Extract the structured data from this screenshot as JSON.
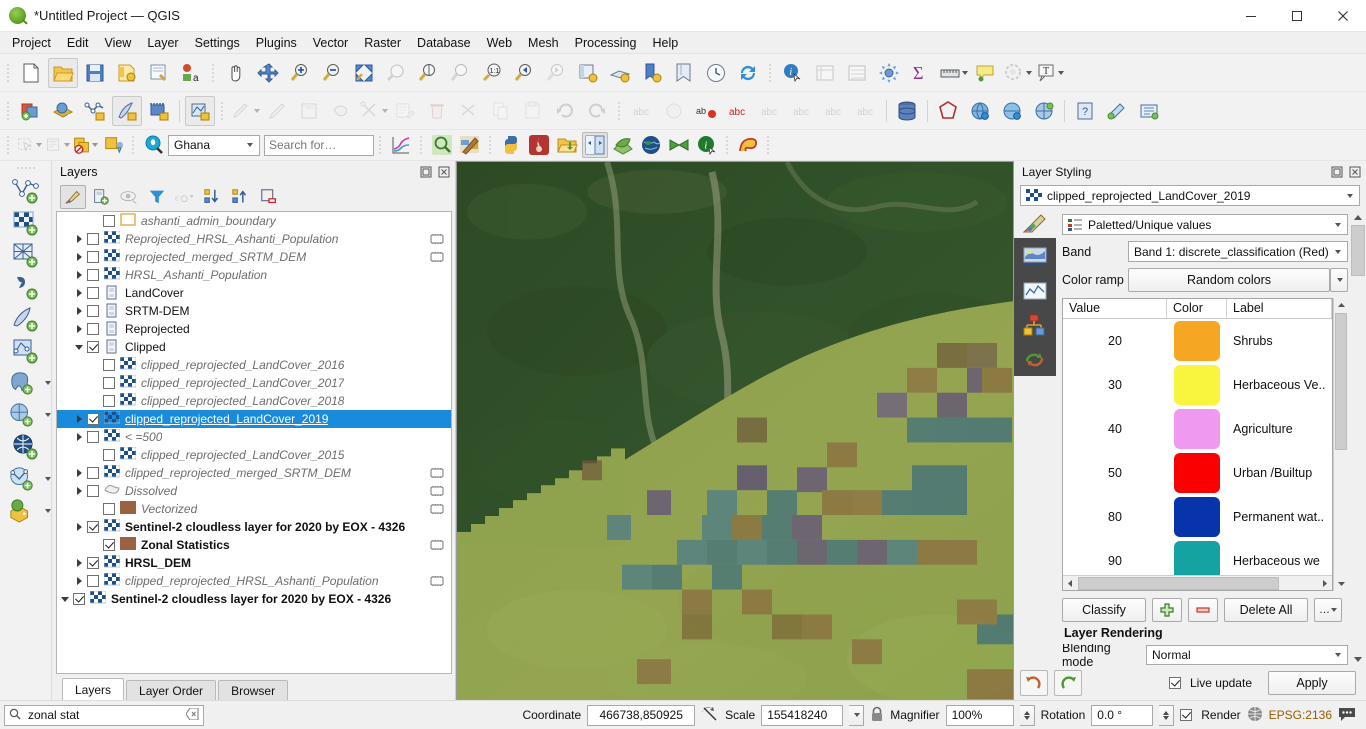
{
  "window": {
    "title": "*Untitled Project — QGIS",
    "app_icon": "qgis-logo-icon",
    "minimize_label": "Minimize",
    "maximize_label": "Maximize",
    "close_label": "Close"
  },
  "menubar": {
    "items": [
      {
        "label": "Project"
      },
      {
        "label": "Edit"
      },
      {
        "label": "View"
      },
      {
        "label": "Layer"
      },
      {
        "label": "Settings"
      },
      {
        "label": "Plugins"
      },
      {
        "label": "Vector"
      },
      {
        "label": "Raster"
      },
      {
        "label": "Database"
      },
      {
        "label": "Web"
      },
      {
        "label": "Mesh"
      },
      {
        "label": "Processing"
      },
      {
        "label": "Help"
      }
    ]
  },
  "toolbar_row1": {
    "buttons": [
      {
        "name": "new-project-icon",
        "title": "New Project"
      },
      {
        "name": "open-project-icon",
        "title": "Open Project"
      },
      {
        "name": "save-project-icon",
        "title": "Save Project"
      },
      {
        "name": "save-project-as-icon",
        "title": "Save Project As"
      },
      {
        "name": "new-print-layout-icon",
        "title": "New Print Layout"
      },
      {
        "name": "style-manager-icon",
        "title": "Style Manager"
      },
      {
        "name": "pan-map-icon",
        "title": "Pan Map"
      },
      {
        "name": "pan-to-selection-icon",
        "title": "Pan Map to Selection"
      },
      {
        "name": "zoom-in-icon",
        "title": "Zoom In"
      },
      {
        "name": "zoom-out-icon",
        "title": "Zoom Out"
      },
      {
        "name": "zoom-full-icon",
        "title": "Zoom Full"
      },
      {
        "name": "zoom-to-selection-icon",
        "title": "Zoom to Selection"
      },
      {
        "name": "zoom-to-layer-icon",
        "title": "Zoom to Layer"
      },
      {
        "name": "zoom-native-icon",
        "title": "Zoom to Native Resolution"
      },
      {
        "name": "zoom-last-icon",
        "title": "Zoom Last"
      },
      {
        "name": "zoom-next-icon",
        "title": "Zoom Next"
      },
      {
        "name": "new-map-view-icon",
        "title": "New Map View"
      },
      {
        "name": "new-3d-map-view-icon",
        "title": "New 3D Map View"
      },
      {
        "name": "bookmark-add-icon",
        "title": "New Spatial Bookmark"
      },
      {
        "name": "show-bookmarks-icon",
        "title": "Show Spatial Bookmarks"
      },
      {
        "name": "temporal-controller-icon",
        "title": "Temporal Controller Panel"
      },
      {
        "name": "refresh-icon",
        "title": "Refresh"
      },
      {
        "name": "identify-features-icon",
        "title": "Identify Features"
      },
      {
        "name": "attribute-table-icon",
        "title": "Open Attribute Table"
      },
      {
        "name": "statistical-summary-icon",
        "title": "Statistical Summary"
      },
      {
        "name": "options-icon",
        "title": "Options"
      },
      {
        "name": "sum-icon",
        "title": "Field Calculator"
      },
      {
        "name": "measure-line-icon",
        "title": "Measure Line"
      },
      {
        "name": "map-tips-icon",
        "title": "Show Map Tips"
      },
      {
        "name": "deselect-features-icon",
        "title": "Deselect Features"
      },
      {
        "name": "text-annotation-icon",
        "title": "Text Annotation"
      }
    ]
  },
  "toolbar_row2": {
    "buttons": [
      {
        "name": "add-layer-icon",
        "title": "Add Layer"
      },
      {
        "name": "open-data-source-manager-icon",
        "title": "Open Data Source Manager"
      },
      {
        "name": "add-vector-layer-icon",
        "title": "Add Vector Layer"
      },
      {
        "name": "add-raster-layer-icon",
        "title": "Add Raster Layer"
      },
      {
        "name": "add-mesh-layer-icon",
        "title": "Add Mesh Layer"
      },
      {
        "name": "add-delimited-text-layer-icon",
        "title": "Add Delimited Text Layer"
      },
      {
        "name": "current-edits-icon",
        "title": "Current Edits"
      },
      {
        "name": "toggle-editing-icon",
        "title": "Toggle Editing"
      },
      {
        "name": "save-layer-edits-icon",
        "title": "Save Layer Edits"
      },
      {
        "name": "add-polygon-feature-icon",
        "title": "Add Polygon Feature"
      },
      {
        "name": "vertex-tool-icon",
        "title": "Vertex Tool"
      },
      {
        "name": "modify-attributes-icon",
        "title": "Modify Attributes of Features"
      },
      {
        "name": "delete-selected-icon",
        "title": "Delete Selected"
      },
      {
        "name": "cut-features-icon",
        "title": "Cut Features"
      },
      {
        "name": "copy-features-icon",
        "title": "Copy Features"
      },
      {
        "name": "paste-features-icon",
        "title": "Paste Features"
      },
      {
        "name": "undo-icon",
        "title": "Undo"
      },
      {
        "name": "redo-icon",
        "title": "Redo"
      },
      {
        "name": "label-abc-icon",
        "title": "Layer Labeling Options"
      },
      {
        "name": "pin-labels-icon",
        "title": "Pin Labels"
      },
      {
        "name": "highlight-labels-icon",
        "title": "Highlight Pinned Labels"
      },
      {
        "name": "move-label-icon",
        "title": "Move Label"
      },
      {
        "name": "rotate-label-icon",
        "title": "Rotate Label"
      },
      {
        "name": "change-label-icon",
        "title": "Change Label"
      },
      {
        "name": "show-hide-labels-icon",
        "title": "Show/Hide Labels"
      },
      {
        "name": "database-icon",
        "title": "DB Manager"
      },
      {
        "name": "georeferencer-icon",
        "title": "Georeferencer"
      },
      {
        "name": "metasearch-icon",
        "title": "MetaSearch"
      },
      {
        "name": "qgis-cloud-icon",
        "title": "QGIS Cloud"
      },
      {
        "name": "globe-network-icon",
        "title": "Network"
      },
      {
        "name": "help-icon",
        "title": "Help"
      },
      {
        "name": "plugin-icon",
        "title": "Plugins"
      },
      {
        "name": "processing-toolbox-icon",
        "title": "Processing Toolbox"
      }
    ]
  },
  "toolbar_row3": {
    "buttons_left": [
      {
        "name": "select-features-icon",
        "title": "Select Features"
      },
      {
        "name": "select-by-form-icon",
        "title": "Select Features by Value"
      },
      {
        "name": "deselect-all-icon",
        "title": "Deselect All"
      },
      {
        "name": "select-by-location-icon",
        "title": "Select by Location"
      }
    ],
    "geocoder": {
      "icon": "location-pin-search-icon",
      "country_value": "Ghana",
      "search_placeholder": "Search for…",
      "search_value": ""
    },
    "buttons_right": [
      {
        "name": "plot-chart-icon",
        "title": "Data Plotly"
      },
      {
        "name": "search-magnifier-icon",
        "title": "Search"
      },
      {
        "name": "map-painting-icon",
        "title": "Map Styling"
      },
      {
        "name": "python-console-icon",
        "title": "Python Console"
      },
      {
        "name": "qgis-resource-sharing-icon",
        "title": "Resource Sharing"
      },
      {
        "name": "open-folder-icon",
        "title": "Open Folder"
      },
      {
        "name": "compare-panels-icon",
        "title": "Compare"
      },
      {
        "name": "leaf-qgis2web-icon",
        "title": "qgis2web"
      },
      {
        "name": "globe-dark-icon",
        "title": "Globe"
      },
      {
        "name": "green-mesh-icon",
        "title": "Mesh Tools"
      },
      {
        "name": "info-identify-icon",
        "title": "Info"
      },
      {
        "name": "freehand-draw-icon",
        "title": "Freehand Drawing"
      }
    ]
  },
  "left_toolbar": {
    "buttons": [
      {
        "name": "add-vector-layer-icon",
        "title": "Add Vector Layer"
      },
      {
        "name": "add-raster-layer-icon",
        "title": "Add Raster Layer"
      },
      {
        "name": "add-mesh-layer-icon",
        "title": "Add Mesh Layer"
      },
      {
        "name": "add-delimited-text-layer-icon",
        "title": "Add Delimited Text Layer"
      },
      {
        "name": "add-spatialite-layer-icon",
        "title": "Add SpatiaLite Layer"
      },
      {
        "name": "add-vector-tile-layer-icon",
        "title": "Add Vector Tile Layer"
      },
      {
        "name": "add-postgis-layer-icon",
        "title": "Add PostGIS Layer"
      },
      {
        "name": "add-wms-layer-icon",
        "title": "Add WMS/WMTS Layer"
      },
      {
        "name": "add-wfs-layer-icon",
        "title": "Add WFS Layer"
      },
      {
        "name": "add-wcs-layer-icon",
        "title": "Add WCS Layer"
      },
      {
        "name": "add-3d-layer-icon",
        "title": "Add 3D Layer"
      }
    ]
  },
  "layers_panel": {
    "title": "Layers",
    "undock_label": "Undock",
    "close_label": "Close",
    "toolbar": [
      {
        "name": "open-layer-styling-panel-icon",
        "title": "Open the Layer Styling panel",
        "active": true
      },
      {
        "name": "add-group-icon",
        "title": "Add Group"
      },
      {
        "name": "manage-layer-visibility-icon",
        "title": "Manage Map Themes"
      },
      {
        "name": "filter-legend-icon",
        "title": "Filter Legend by Map Content"
      },
      {
        "name": "filter-legend-expression-icon",
        "title": "Filter Legend by Expression"
      },
      {
        "name": "expand-all-icon",
        "title": "Expand All"
      },
      {
        "name": "collapse-all-icon",
        "title": "Collapse All"
      },
      {
        "name": "remove-layer-icon",
        "title": "Remove Layer/Group"
      }
    ],
    "tree": [
      {
        "label": "ashanti_admin_boundary",
        "icon": "polygon-outline-icon",
        "checked": false,
        "expander": "none",
        "indent": 1,
        "style": "italic",
        "chip": false
      },
      {
        "label": "Reprojected_HRSL_Ashanti_Population",
        "icon": "raster-icon",
        "checked": false,
        "expander": "right",
        "indent": 0,
        "style": "italic",
        "chip": true
      },
      {
        "label": "reprojected_merged_SRTM_DEM",
        "icon": "raster-icon",
        "checked": false,
        "expander": "right",
        "indent": 0,
        "style": "italic",
        "chip": true
      },
      {
        "label": "HRSL_Ashanti_Population",
        "icon": "raster-icon",
        "checked": false,
        "expander": "right",
        "indent": 0,
        "style": "italic",
        "chip": false
      },
      {
        "label": "LandCover",
        "icon": "group-icon",
        "checked": false,
        "expander": "right",
        "indent": 0,
        "style": "normal",
        "chip": false
      },
      {
        "label": "SRTM-DEM",
        "icon": "group-icon",
        "checked": false,
        "expander": "right",
        "indent": 0,
        "style": "normal",
        "chip": false
      },
      {
        "label": "Reprojected",
        "icon": "group-icon",
        "checked": false,
        "expander": "right",
        "indent": 0,
        "style": "normal",
        "chip": false
      },
      {
        "label": "Clipped",
        "icon": "group-icon",
        "checked": true,
        "expander": "down",
        "indent": 0,
        "style": "normal",
        "chip": false
      },
      {
        "label": "clipped_reprojected_LandCover_2016",
        "icon": "raster-icon",
        "checked": false,
        "expander": "none",
        "indent": 1,
        "style": "italic",
        "chip": false
      },
      {
        "label": "clipped_reprojected_LandCover_2017",
        "icon": "raster-icon",
        "checked": false,
        "expander": "none",
        "indent": 1,
        "style": "italic",
        "chip": false
      },
      {
        "label": "clipped_reprojected_LandCover_2018",
        "icon": "raster-icon",
        "checked": false,
        "expander": "none",
        "indent": 1,
        "style": "italic",
        "chip": false
      },
      {
        "label": "clipped_reprojected_LandCover_2019",
        "icon": "raster-icon",
        "checked": true,
        "expander": "right",
        "indent": 0,
        "style": "selected",
        "chip": false,
        "selected": true
      },
      {
        "label": "< =500",
        "icon": "raster-icon",
        "checked": false,
        "expander": "right",
        "indent": 0,
        "style": "italic",
        "chip": false
      },
      {
        "label": "clipped_reprojected_LandCover_2015",
        "icon": "raster-icon",
        "checked": false,
        "expander": "none",
        "indent": 1,
        "style": "italic",
        "chip": false
      },
      {
        "label": "clipped_reprojected_merged_SRTM_DEM",
        "icon": "raster-icon",
        "checked": false,
        "expander": "right",
        "indent": 0,
        "style": "italic",
        "chip": true
      },
      {
        "label": "Dissolved",
        "icon": "polygon-gray-icon",
        "checked": false,
        "expander": "right",
        "indent": 0,
        "style": "italic",
        "chip": true
      },
      {
        "label": "Vectorized",
        "icon": "polygon-brown-icon",
        "checked": false,
        "expander": "none",
        "indent": 1,
        "style": "italic",
        "chip": true
      },
      {
        "label": "Sentinel-2 cloudless layer for 2020 by EOX - 4326",
        "icon": "raster-icon",
        "checked": true,
        "expander": "right",
        "indent": 0,
        "style": "bold",
        "chip": false
      },
      {
        "label": "Zonal Statistics",
        "icon": "polygon-brown-icon",
        "checked": true,
        "expander": "none",
        "indent": 1,
        "style": "bold",
        "chip": true
      },
      {
        "label": "HRSL_DEM",
        "icon": "raster-icon",
        "checked": true,
        "expander": "right",
        "indent": 0,
        "style": "bold",
        "chip": false
      },
      {
        "label": "clipped_reprojected_HRSL_Ashanti_Population",
        "icon": "raster-icon",
        "checked": false,
        "expander": "right",
        "indent": 0,
        "style": "italic",
        "chip": true
      },
      {
        "label": "Sentinel-2 cloudless layer for 2020 by EOX - 4326",
        "icon": "raster-icon",
        "checked": true,
        "expander": "down",
        "indent": -1,
        "style": "bold",
        "chip": false
      }
    ],
    "tabs": [
      {
        "label": "Layers",
        "active": true
      },
      {
        "label": "Layer Order",
        "active": false
      },
      {
        "label": "Browser",
        "active": false
      }
    ]
  },
  "style_panel": {
    "title": "Layer Styling",
    "undock_label": "Undock",
    "close_label": "Close",
    "layer_selector": {
      "icon": "raster-icon",
      "value": "clipped_reprojected_LandCover_2019"
    },
    "side_buttons": [
      {
        "name": "symbology-brush-icon",
        "title": "Symbology"
      },
      {
        "name": "transparency-icon",
        "title": "Transparency"
      },
      {
        "name": "histogram-icon",
        "title": "Histogram"
      },
      {
        "name": "rendering-pyramids-icon",
        "title": "Rendering"
      },
      {
        "name": "history-undo-redo-icon",
        "title": "History"
      }
    ],
    "renderer": {
      "value": "Paletted/Unique values",
      "icon": "palette-list-icon"
    },
    "band": {
      "label": "Band",
      "value": "Band 1: discrete_classification (Red)"
    },
    "color_ramp": {
      "label": "Color ramp",
      "value": "Random colors"
    },
    "table": {
      "headers": [
        "Value",
        "Color",
        "Label"
      ],
      "rows": [
        {
          "value": "20",
          "color": "#f5a623",
          "label": "Shrubs"
        },
        {
          "value": "30",
          "color": "#f9f43e",
          "label": "Herbaceous Ve.."
        },
        {
          "value": "40",
          "color": "#ef9af0",
          "label": "Agriculture"
        },
        {
          "value": "50",
          "color": "#fb0000",
          "label": "Urban /Builtup"
        },
        {
          "value": "80",
          "color": "#0733ab",
          "label": "Permanent wat.."
        },
        {
          "value": "90",
          "color": "#14a3a0",
          "label": "Herbaceous we"
        }
      ]
    },
    "buttons": {
      "classify": "Classify",
      "add": "add-entry-icon",
      "remove": "remove-entry-icon",
      "delete_all": "Delete All",
      "more": "…"
    },
    "layer_rendering_title": "Layer Rendering",
    "blending_label": "Blending mode",
    "blending_value": "Normal",
    "footer": {
      "undo": "undo-icon",
      "redo": "redo-icon",
      "live_update_label": "Live update",
      "live_update_checked": true,
      "apply_label": "Apply"
    }
  },
  "statusbar": {
    "search_placeholder": "zonal stat",
    "search_value": "zonal stat",
    "search_icon": "search-icon",
    "clear_icon": "clear-icon",
    "coordinate_label": "Coordinate",
    "coordinate_value": "466738,850925",
    "toggle_extents_icon": "toggle-extents-icon",
    "scale_label": "Scale",
    "scale_value": "155418240",
    "lock_icon": "lock-icon",
    "magnifier_label": "Magnifier",
    "magnifier_value": "100%",
    "rotation_label": "Rotation",
    "rotation_value": "0.0 °",
    "render_label": "Render",
    "render_checked": true,
    "epsg_label": "EPSG:2136",
    "epsg_icon": "globe-crs-icon",
    "messages_icon": "messages-icon"
  },
  "colors": {
    "selection_blue": "#1a8bdc",
    "panel_bg": "#f0f0f0",
    "epsg_orange": "#9a5a00"
  }
}
